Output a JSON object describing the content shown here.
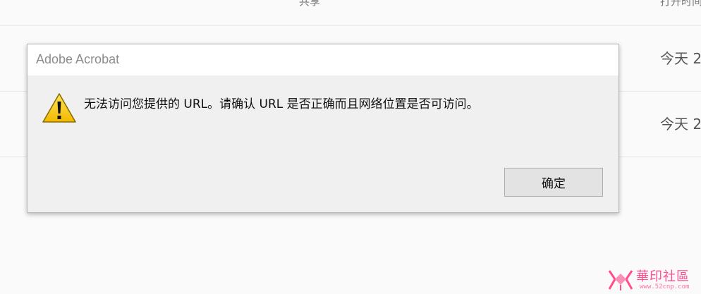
{
  "background": {
    "columns": {
      "share": "共享",
      "opened": "打开时间"
    },
    "rows": [
      {
        "date": "今天 2"
      },
      {
        "date": "今天 2"
      }
    ]
  },
  "dialog": {
    "title": "Adobe Acrobat",
    "icon": "warning-icon",
    "message": "无法访问您提供的 URL。请确认 URL 是否正确而且网络位置是否可访问。",
    "ok_label": "确定"
  },
  "watermark": {
    "text": "華印社區",
    "url": "www.52cnp.com"
  },
  "colors": {
    "warning_yellow": "#f5c400",
    "watermark_pink": "#ff4d8d"
  }
}
